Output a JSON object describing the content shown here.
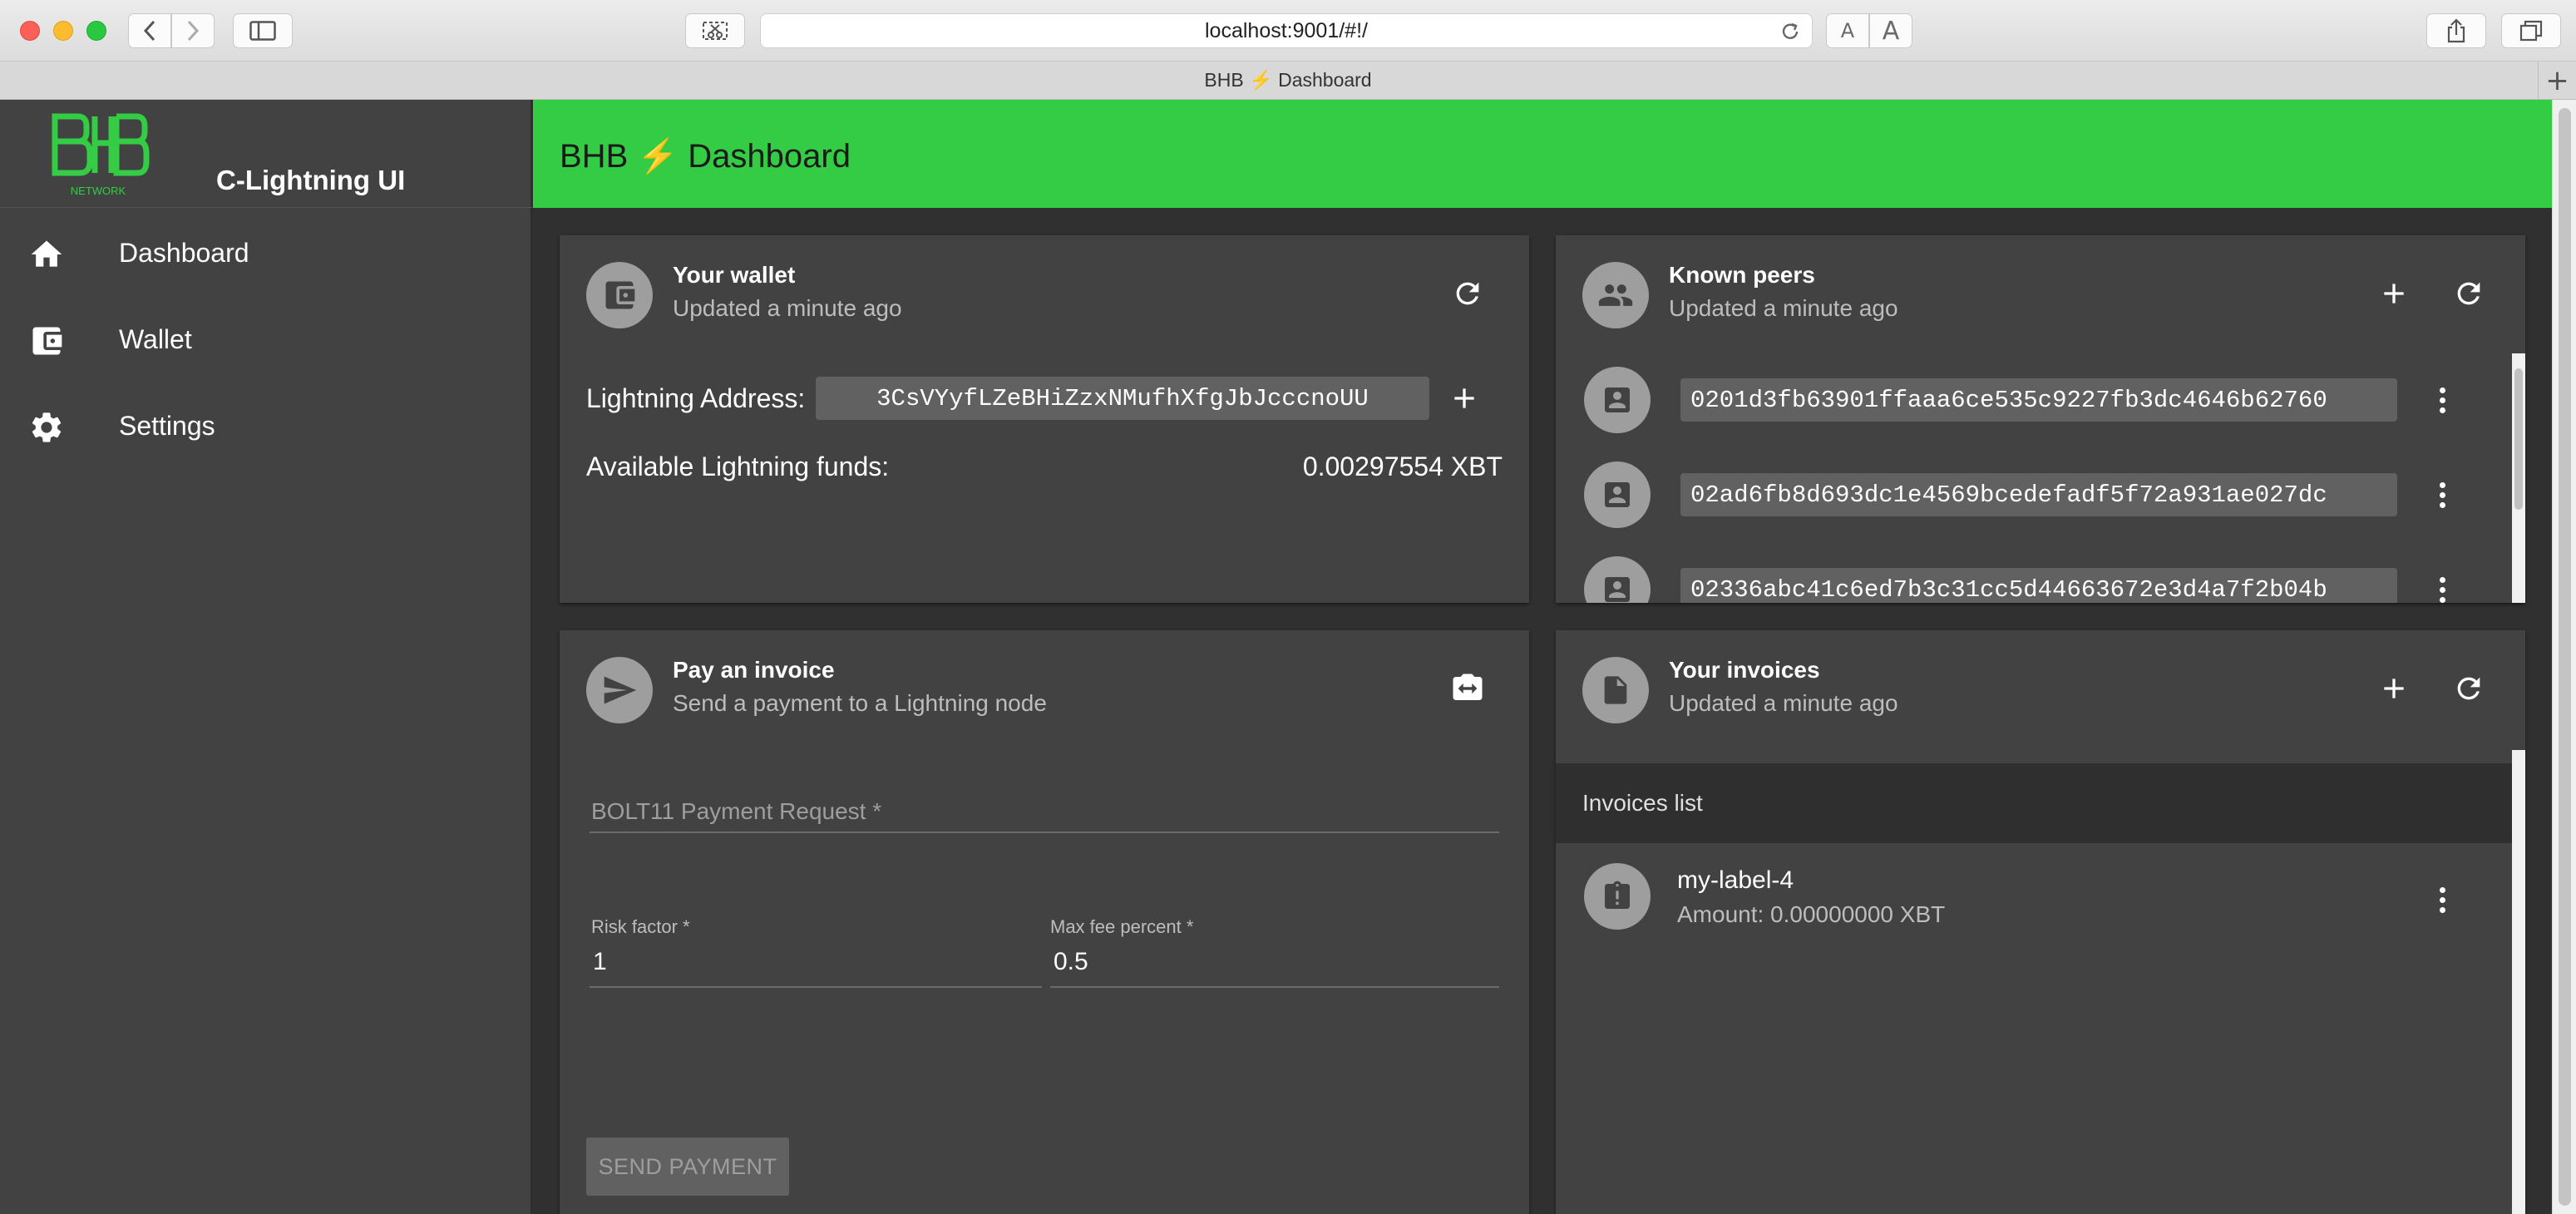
{
  "browser": {
    "url": "localhost:9001/#!/",
    "tab_title": "BHB ⚡ Dashboard",
    "new_tab_glyph": "+",
    "reader_small": "A",
    "reader_large": "A"
  },
  "sidebar": {
    "logo_text": "NETWORK",
    "app_name": "C-Lightning UI",
    "items": [
      {
        "label": "Dashboard",
        "icon": "home-icon"
      },
      {
        "label": "Wallet",
        "icon": "wallet-icon"
      },
      {
        "label": "Settings",
        "icon": "gear-icon"
      }
    ]
  },
  "header": {
    "title": "BHB ⚡ Dashboard"
  },
  "wallet": {
    "title": "Your wallet",
    "subtitle": "Updated a minute ago",
    "address_label": "Lightning Address:",
    "address_value": "3CsVYyfLZeBHiZzxNMufhXfgJbJcccnoUU",
    "funds_label": "Available Lightning funds:",
    "funds_value": "0.00297554 XBT"
  },
  "peers": {
    "title": "Known peers",
    "subtitle": "Updated a minute ago",
    "items": [
      "0201d3fb63901ffaaa6ce535c9227fb3dc4646b62760",
      "02ad6fb8d693dc1e4569bcedefadf5f72a931ae027dc",
      "02336abc41c6ed7b3c31cc5d44663672e3d4a7f2b04b"
    ]
  },
  "pay": {
    "title": "Pay an invoice",
    "subtitle": "Send a payment to a Lightning node",
    "bolt11_placeholder": "BOLT11 Payment Request *",
    "risk_label": "Risk factor *",
    "risk_value": "1",
    "maxfee_label": "Max fee percent *",
    "maxfee_value": "0.5",
    "send_label": "SEND PAYMENT"
  },
  "invoices": {
    "title": "Your invoices",
    "subtitle": "Updated a minute ago",
    "list_header": "Invoices list",
    "items": [
      {
        "label": "my-label-4",
        "amount": "Amount: 0.00000000 XBT"
      }
    ]
  },
  "colors": {
    "accent": "#33cc44",
    "card": "#424242",
    "background": "#303030"
  }
}
